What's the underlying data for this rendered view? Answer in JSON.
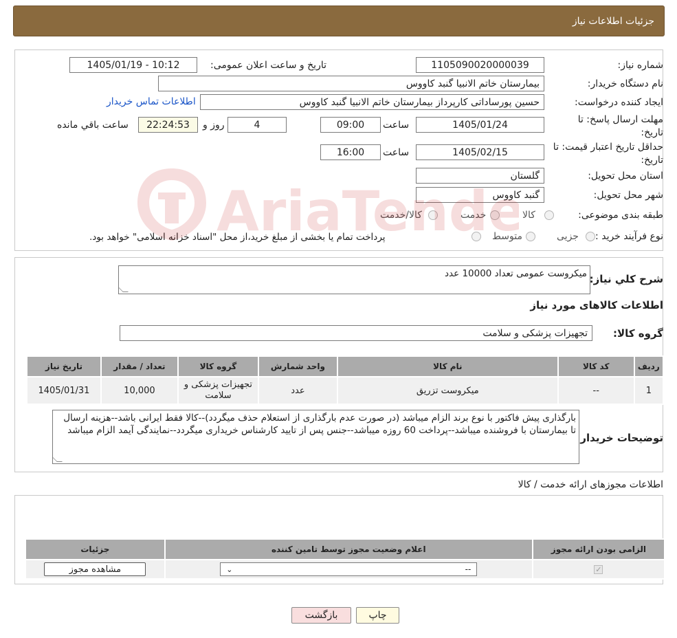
{
  "header": {
    "title": "جزئیات اطلاعات نیاز"
  },
  "form": {
    "need_number_label": "شماره نیاز:",
    "need_number": "1105090020000039",
    "announce_label": "تاریخ و ساعت اعلان عمومی:",
    "announce_value": "1405/01/19 - 10:12",
    "buyer_org_label": "نام دستگاه خریدار:",
    "buyer_org": "بیمارستان خاتم الانبیا گنبد کاووس",
    "requester_label": "ایجاد کننده درخواست:",
    "requester": "حسین پورساداتی کارپرداز بیمارستان خاتم الانبیا گنبد کاووس",
    "contact_link": "اطلاعات تماس خریدار",
    "deadline_label": "مهلت ارسال پاسخ: تا تاریخ:",
    "deadline_date": "1405/01/24",
    "time_label": "ساعت",
    "deadline_time": "09:00",
    "days_value": "4",
    "days_label": "روز و",
    "remaining_value": "22:24:53",
    "remaining_label": "ساعت باقي مانده",
    "price_validity_label": "حداقل تاریخ اعتبار قیمت: تا تاریخ:",
    "price_validity_date": "1405/02/15",
    "price_validity_time": "16:00",
    "province_label": "استان محل تحویل:",
    "province": "گلستان",
    "city_label": "شهر محل تحویل:",
    "city": "گنبد کاووس",
    "category_label": "طبقه بندی موضوعی:",
    "category_options": [
      "کالا",
      "خدمت",
      "کالا/خدمت"
    ],
    "process_label": "نوع فرآیند خرید :",
    "process_options": [
      "جزیی",
      "متوسط"
    ],
    "process_note": "پرداخت تمام یا بخشی از مبلغ خرید،از محل \"اسناد خزانه اسلامی\" خواهد بود."
  },
  "description": {
    "label": "شرح کلي نياز:",
    "value": "میکروست عمومی تعداد 10000 عدد"
  },
  "goods": {
    "section_title": "اطلاعات کالاهای مورد نیاز",
    "group_label": "گروه کالا:",
    "group_value": "تجهیزات پزشکی و سلامت",
    "columns": [
      "ردیف",
      "کد کالا",
      "نام کالا",
      "واحد شمارش",
      "گروه کالا",
      "تعداد / مقدار",
      "تاریخ نیاز"
    ],
    "rows": [
      [
        "1",
        "--",
        "میکروست تزریق",
        "عدد",
        "تجهیزات پزشکی و سلامت",
        "10,000",
        "1405/01/31"
      ]
    ]
  },
  "buyer_notes": {
    "label": "توضیحات خریدار:",
    "value": "بارگذاری پیش فاکتور با نوع برند الزام میباشد (در صورت عدم بارگذاری از استعلام حذف میگردد)--کالا فقط ایرانی باشد--هزینه ارسال تا بیمارستان با فروشنده میباشد--پرداخت 60 روزه میباشد--جنس پس از تایید کارشناس خریداری میگردد--نمایندگی آیمد الزام میباشد"
  },
  "permits": {
    "section_title": "اطلاعات مجوزهای ارائه خدمت / کالا",
    "columns": [
      "الزامی بودن ارائه مجوز",
      "اعلام وضعیت مجوز توسط تامین کننده",
      "جزئیات"
    ],
    "select_value": "--",
    "view_button": "مشاهده مجوز"
  },
  "footer": {
    "print_button": "چاپ",
    "back_button": "بازگشت"
  },
  "watermark": {
    "text": "AriaTender.neT"
  }
}
